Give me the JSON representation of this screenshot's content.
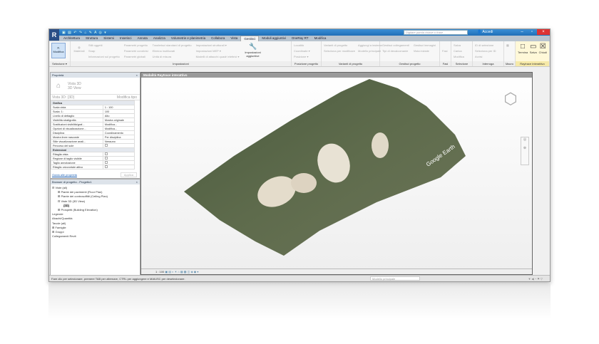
{
  "titlebar": {
    "search_placeholder": "Digitare parola chiave o frase",
    "accedi": "Accedi"
  },
  "tabs": [
    "Architettura",
    "Struttura",
    "Sistemi",
    "Inserisci",
    "Annota",
    "Analizza",
    "Volumetrie e planimetria",
    "Collabora",
    "Vista",
    "Gestisci",
    "Moduli aggiuntivi",
    "OneRay RT",
    "Modifica"
  ],
  "active_tab": "Gestisci",
  "ribbon": {
    "modifica": "Modifica",
    "selezione": "Selezione ▾",
    "materiali": "Materiali",
    "impostazioni_items": [
      "Stili oggetti",
      "Snap",
      "Informazioni sul progetto",
      "Parametri progetto",
      "Parametri condivisi",
      "Parametri globali",
      "Trasferisci standard di progetto",
      "Elimina inutilizzati",
      "Unità di misura",
      "Impostazioni strutturali ▾",
      "Impostazioni MEP ▾",
      "Modelli di attacchi quadri elettrici ▾"
    ],
    "impostazioni_aggiuntive": "Impostazioni aggiuntive",
    "impostazioni_label": "Impostazioni",
    "posizione_items": [
      "Località",
      "Coordinate ▾",
      "Posizione ▾"
    ],
    "posizione_label": "Posizione progetto",
    "varianti_items": [
      "Varianti di progetto",
      "Aggiungi a insieme",
      "Seleziona per modificare",
      "Modello principale"
    ],
    "varianti_label": "Varianti di progetto",
    "gestisci_items": [
      "Gestisci collegamenti",
      "Gestisci immagini",
      "Tipi di decalcomanie",
      "Vista iniziale"
    ],
    "gestisci_label": "Gestisci progetto",
    "fasi": "Fasi",
    "fasi_label": "Fasi",
    "selezione_items": [
      "Salva",
      "Carica",
      "Modifica"
    ],
    "selezione_label": "Selezione",
    "interroga_items": [
      "ID di selezione",
      "Seleziona per ID",
      "Avvisi"
    ],
    "interroga_label": "Interroga",
    "macro_label": "Macro",
    "ray_items": [
      "Termina",
      "Salva",
      "Chiudi"
    ],
    "ray_label": "Raytrace interattivo"
  },
  "properties": {
    "title": "Proprietà",
    "type_name": "Vista 3D",
    "type_sub": "3D View",
    "selector": "Vista 3D: {3D}",
    "edit_type": "Modifica tipo",
    "sections": [
      {
        "name": "Grafica",
        "rows": [
          [
            "Scala vista",
            "1 : 100"
          ],
          [
            "Scala: 1:",
            "100"
          ],
          [
            "Livello di dettaglio",
            "Alto"
          ],
          [
            "Visibilità stratigrafia",
            "Mostra originale"
          ],
          [
            "Sostituzioni visibilità/graf...",
            "Modifica..."
          ],
          [
            "Opzioni di visualizzazione...",
            "Modifica..."
          ],
          [
            "Disciplina",
            "Coordinamento"
          ],
          [
            "Mostra linee nascoste",
            "Per disciplina"
          ],
          [
            "Stile visualizzazione anali...",
            "Nessuno"
          ],
          [
            "Percorso del sole",
            ""
          ]
        ]
      },
      {
        "name": "Estensioni",
        "rows": [
          [
            "Ritaglia vista",
            ""
          ],
          [
            "Regione di taglio visibile",
            ""
          ],
          [
            "Taglio annotazione",
            ""
          ],
          [
            "Ritaglio orizzontale attivo",
            ""
          ]
        ]
      }
    ],
    "help_link": "Guida alle proprietà",
    "apply": "Applica"
  },
  "browser": {
    "title": "Browser di progetto - Progetto1",
    "nodes": [
      {
        "label": "Viste (all)",
        "level": 0,
        "toggle": "⊟"
      },
      {
        "label": "Piante dei pavimenti (Floor Plan)",
        "level": 1,
        "toggle": "⊞"
      },
      {
        "label": "Piante dei controsoffitti (Ceiling Plan)",
        "level": 1,
        "toggle": "⊞"
      },
      {
        "label": "Viste 3D (3D View)",
        "level": 1,
        "toggle": "⊟"
      },
      {
        "label": "{3D}",
        "level": 2,
        "toggle": ""
      },
      {
        "label": "Prospetti (Building Elevation)",
        "level": 1,
        "toggle": "⊞"
      },
      {
        "label": "Legende",
        "level": 0,
        "toggle": ""
      },
      {
        "label": "Abachi/Quantità",
        "level": 0,
        "toggle": ""
      },
      {
        "label": "Tavole (all)",
        "level": 0,
        "toggle": ""
      },
      {
        "label": "Famiglie",
        "level": 0,
        "toggle": "⊞"
      },
      {
        "label": "Gruppi",
        "level": 0,
        "toggle": "⊞"
      },
      {
        "label": "Collegamenti Revit",
        "level": 0,
        "toggle": ""
      }
    ]
  },
  "view": {
    "title": "Modalità Raytrace interattivo",
    "scale": "1 : 100",
    "watermark": "Google Earth"
  },
  "status": {
    "text": "Fare clic per selezionare, premere TAB per alternare, CTRL per aggiungere e MAIUSC per deselezionare.",
    "model": "Modello principale"
  }
}
